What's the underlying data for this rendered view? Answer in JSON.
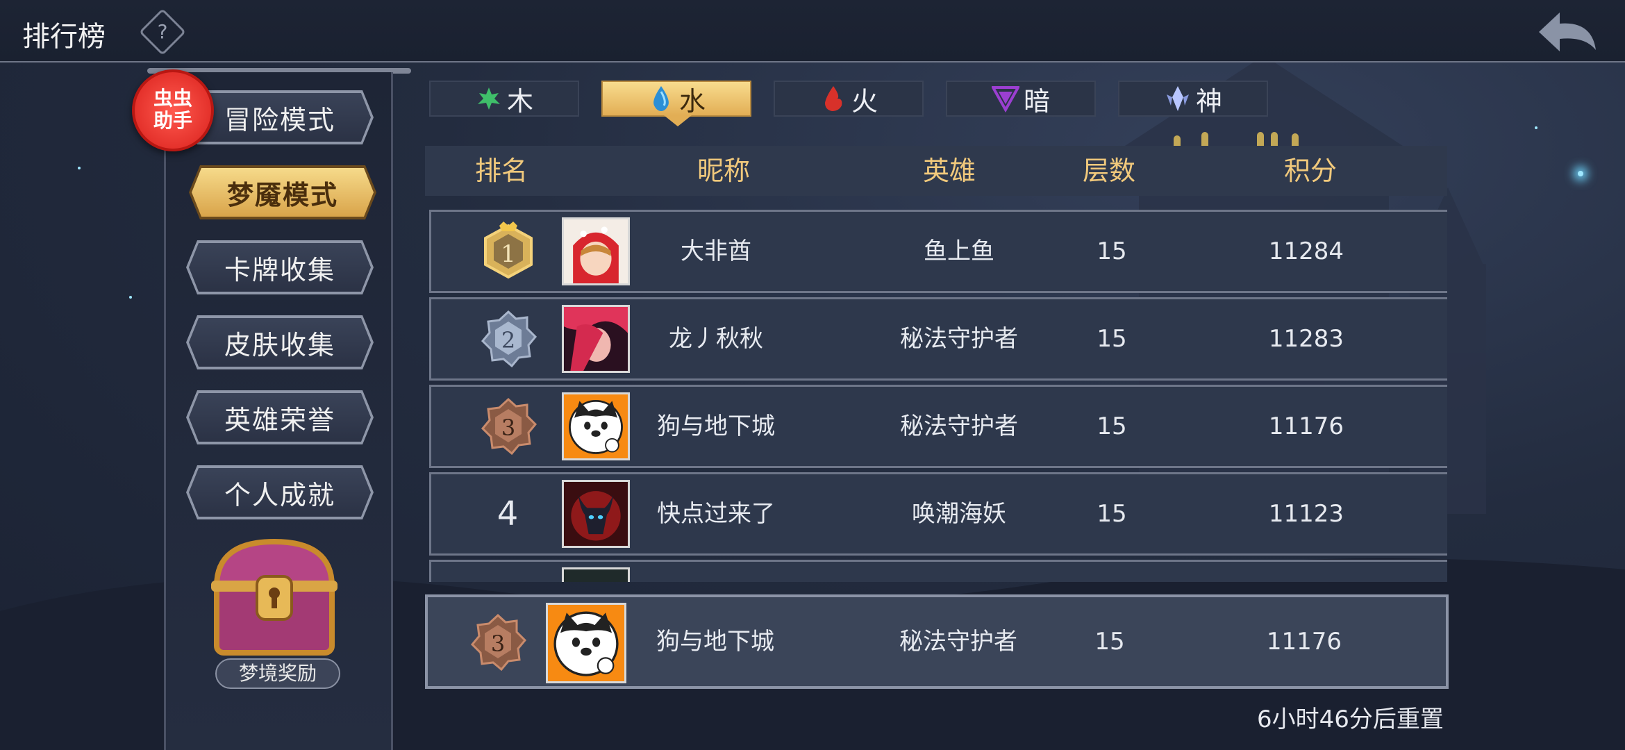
{
  "header": {
    "title": "排行榜",
    "help_icon": "question-diamond-icon",
    "back_icon": "back-arrow-icon"
  },
  "badge": {
    "line1": "虫虫",
    "line2": "助手"
  },
  "modes": [
    {
      "label": "冒险模式",
      "active": false
    },
    {
      "label": "梦魇模式",
      "active": true
    },
    {
      "label": "卡牌收集",
      "active": false
    },
    {
      "label": "皮肤收集",
      "active": false
    },
    {
      "label": "英雄荣誉",
      "active": false
    },
    {
      "label": "个人成就",
      "active": false
    }
  ],
  "reward": {
    "label": "梦境奖励",
    "icon": "treasure-chest-icon"
  },
  "element_tabs": [
    {
      "label": "木",
      "icon": "leaf-icon",
      "color": "#3fbf6a",
      "active": false
    },
    {
      "label": "水",
      "icon": "water-drop-icon",
      "color": "#2b8fd6",
      "active": true
    },
    {
      "label": "火",
      "icon": "fire-icon",
      "color": "#d8312a",
      "active": false
    },
    {
      "label": "暗",
      "icon": "dark-triangle-icon",
      "color": "#9b3fd1",
      "active": false
    },
    {
      "label": "神",
      "icon": "divine-crystal-icon",
      "color": "#b8c6ff",
      "active": false
    }
  ],
  "table": {
    "headers": {
      "rank": "排名",
      "nickname": "昵称",
      "hero": "英雄",
      "floors": "层数",
      "score": "积分"
    },
    "rows": [
      {
        "rank": "1",
        "nickname": "大非酋",
        "hero": "鱼上鱼",
        "floors": "15",
        "score": "11284"
      },
      {
        "rank": "2",
        "nickname": "龙丿秋秋",
        "hero": "秘法守护者",
        "floors": "15",
        "score": "11283"
      },
      {
        "rank": "3",
        "nickname": "狗与地下城",
        "hero": "秘法守护者",
        "floors": "15",
        "score": "11176"
      },
      {
        "rank": "4",
        "nickname": "快点过来了",
        "hero": "唤潮海妖",
        "floors": "15",
        "score": "11123"
      }
    ]
  },
  "self_row": {
    "rank": "3",
    "nickname": "狗与地下城",
    "hero": "秘法守护者",
    "floors": "15",
    "score": "11176"
  },
  "reset_text": "6小时46分后重置",
  "colors": {
    "accent_gold": "#f1c97c",
    "panel": "#2e384c",
    "badge_red": "#e02c26"
  }
}
